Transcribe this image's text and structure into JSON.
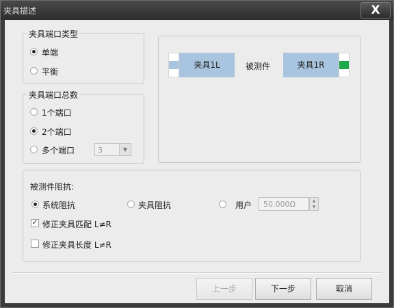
{
  "window": {
    "title": "夹具描述",
    "close_label": "X"
  },
  "port_type": {
    "legend": "夹具端口类型",
    "options": [
      {
        "label": "单端",
        "selected": true
      },
      {
        "label": "平衡",
        "selected": false
      }
    ]
  },
  "port_count": {
    "legend": "夹具端口总数",
    "options": [
      {
        "label": "1个端口",
        "selected": false
      },
      {
        "label": "2个端口",
        "selected": true
      },
      {
        "label": "多个端口",
        "selected": false
      }
    ],
    "multi_value": "3"
  },
  "diagram": {
    "left_fixture": "夹具1L",
    "dut": "被测件",
    "right_fixture": "夹具1R",
    "colors": {
      "fixture": "#a8c4de",
      "left_port": "#a8c4de",
      "right_port": "#1fa84a"
    }
  },
  "impedance": {
    "heading": "被测件阻抗:",
    "options": [
      {
        "label": "系统阻抗",
        "selected": true
      },
      {
        "label": "夹具阻抗",
        "selected": false
      },
      {
        "label": "用户",
        "selected": false
      }
    ],
    "user_value": "50.000Ω",
    "correct_match": {
      "label": "修正夹具匹配 L≠R",
      "checked": true
    },
    "correct_length": {
      "label": "修正夹具长度 L≠R",
      "checked": false
    }
  },
  "buttons": {
    "prev": "上一步",
    "next": "下一步",
    "cancel": "取消"
  }
}
